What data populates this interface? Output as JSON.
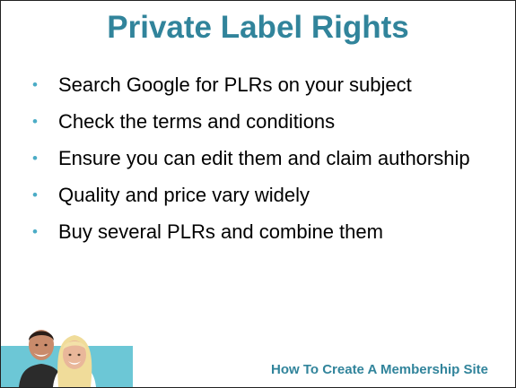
{
  "slide": {
    "title": "Private Label Rights",
    "bullets": [
      "Search Google for PLRs on your subject",
      "Check the terms and conditions",
      "Ensure you can edit them and claim authorship",
      "Quality and price vary widely",
      "Buy several PLRs and combine them"
    ],
    "bullet_glyph": "•",
    "footer": "How To Create A Membership Site"
  },
  "colors": {
    "title": "#31849b",
    "bullet_dot": "#4bacc6",
    "photo_background": "#6cc7d6"
  }
}
